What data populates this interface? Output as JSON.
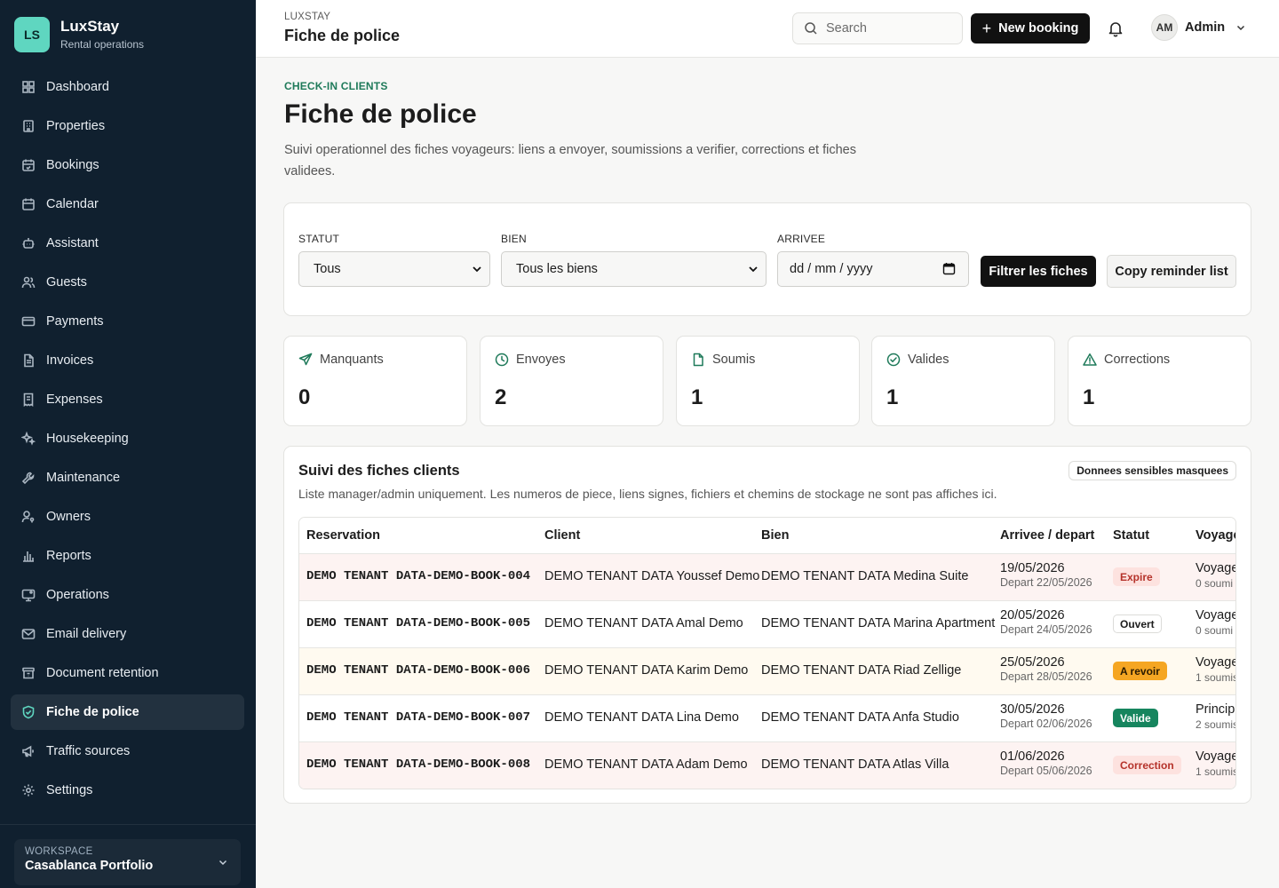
{
  "brand": {
    "initials": "LS",
    "name": "LuxStay",
    "subtitle": "Rental operations"
  },
  "sidebar": {
    "items": [
      {
        "label": "Dashboard",
        "icon": "dashboard-icon"
      },
      {
        "label": "Properties",
        "icon": "building-icon"
      },
      {
        "label": "Bookings",
        "icon": "calendar-check-icon"
      },
      {
        "label": "Calendar",
        "icon": "calendar-icon"
      },
      {
        "label": "Assistant",
        "icon": "bot-icon"
      },
      {
        "label": "Guests",
        "icon": "users-icon"
      },
      {
        "label": "Payments",
        "icon": "credit-card-icon"
      },
      {
        "label": "Invoices",
        "icon": "file-text-icon"
      },
      {
        "label": "Expenses",
        "icon": "receipt-icon"
      },
      {
        "label": "Housekeeping",
        "icon": "sparkles-icon"
      },
      {
        "label": "Maintenance",
        "icon": "wrench-icon"
      },
      {
        "label": "Owners",
        "icon": "user-key-icon"
      },
      {
        "label": "Reports",
        "icon": "bar-chart-icon"
      },
      {
        "label": "Operations",
        "icon": "monitor-icon"
      },
      {
        "label": "Email delivery",
        "icon": "mail-icon"
      },
      {
        "label": "Document retention",
        "icon": "archive-icon"
      },
      {
        "label": "Fiche de police",
        "icon": "shield-check-icon",
        "active": true
      },
      {
        "label": "Traffic sources",
        "icon": "megaphone-icon"
      },
      {
        "label": "Settings",
        "icon": "gear-icon"
      }
    ],
    "workspace": {
      "label": "WORKSPACE",
      "value": "Casablanca Portfolio"
    }
  },
  "topbar": {
    "kicker": "LUXSTAY",
    "title": "Fiche de police",
    "search_placeholder": "Search",
    "new_booking_label": "New booking",
    "user_initials": "AM",
    "user_name": "Admin"
  },
  "page": {
    "kicker": "CHECK-IN CLIENTS",
    "title": "Fiche de police",
    "intro": "Suivi operationnel des fiches voyageurs: liens a envoyer, soumissions a verifier, corrections et fiches validees."
  },
  "filters": {
    "statut": {
      "label": "STATUT",
      "value": "Tous"
    },
    "bien": {
      "label": "BIEN",
      "value": "Tous les biens"
    },
    "arrivee": {
      "label": "ARRIVEE",
      "placeholder": "dd / mm / yyyy"
    },
    "filter_button": "Filtrer les fiches",
    "copy_button": "Copy reminder list"
  },
  "stats": [
    {
      "label": "Manquants",
      "value": "0",
      "icon": "send-icon"
    },
    {
      "label": "Envoyes",
      "value": "2",
      "icon": "clock-icon"
    },
    {
      "label": "Soumis",
      "value": "1",
      "icon": "file-icon"
    },
    {
      "label": "Valides",
      "value": "1",
      "icon": "check-circle-icon"
    },
    {
      "label": "Corrections",
      "value": "1",
      "icon": "alert-triangle-icon"
    }
  ],
  "table": {
    "title": "Suivi des fiches clients",
    "subtitle": "Liste manager/admin uniquement. Les numeros de piece, liens signes, fichiers et chemins de stockage ne sont pas affiches ici.",
    "badge": "Donnees sensibles masquees",
    "headers": [
      "Reservation",
      "Client",
      "Bien",
      "Arrivee / depart",
      "Statut",
      "Voyage"
    ],
    "rows": [
      {
        "reservation": "DEMO TENANT DATA-DEMO-BOOK-004",
        "client": "DEMO TENANT DATA Youssef Demo",
        "bien": "DEMO TENANT DATA Medina Suite",
        "arrivee": "19/05/2026",
        "depart": "Depart 22/05/2026",
        "statut": "Expire",
        "voy1": "Voyage",
        "voy2": "0 soumi",
        "row_bg": "#fdf3f2",
        "status_bg": "#fde2df",
        "status_fg": "#b5322a",
        "status_border": "#fde2df"
      },
      {
        "reservation": "DEMO TENANT DATA-DEMO-BOOK-005",
        "client": "DEMO TENANT DATA Amal Demo",
        "bien": "DEMO TENANT DATA Marina Apartment",
        "arrivee": "20/05/2026",
        "depart": "Depart 24/05/2026",
        "statut": "Ouvert",
        "voy1": "Voyage",
        "voy2": "0 soumi",
        "row_bg": "#ffffff",
        "status_bg": "#ffffff",
        "status_fg": "#1c1c1c",
        "status_border": "#dcdcd9"
      },
      {
        "reservation": "DEMO TENANT DATA-DEMO-BOOK-006",
        "client": "DEMO TENANT DATA Karim Demo",
        "bien": "DEMO TENANT DATA Riad Zellige",
        "arrivee": "25/05/2026",
        "depart": "Depart 28/05/2026",
        "statut": "A revoir",
        "voy1": "Voyage",
        "voy2": "1 soumis",
        "row_bg": "#fffaf0",
        "status_bg": "#f5a623",
        "status_fg": "#2a1a00",
        "status_border": "#f5a623"
      },
      {
        "reservation": "DEMO TENANT DATA-DEMO-BOOK-007",
        "client": "DEMO TENANT DATA Lina Demo",
        "bien": "DEMO TENANT DATA Anfa Studio",
        "arrivee": "30/05/2026",
        "depart": "Depart 02/06/2026",
        "statut": "Valide",
        "voy1": "Princip",
        "voy2": "2 soumis",
        "row_bg": "#ffffff",
        "status_bg": "#16855e",
        "status_fg": "#ffffff",
        "status_border": "#16855e"
      },
      {
        "reservation": "DEMO TENANT DATA-DEMO-BOOK-008",
        "client": "DEMO TENANT DATA Adam Demo",
        "bien": "DEMO TENANT DATA Atlas Villa",
        "arrivee": "01/06/2026",
        "depart": "Depart 05/06/2026",
        "statut": "Correction",
        "voy1": "Voyage",
        "voy2": "1 soumis",
        "row_bg": "#fdf3f2",
        "status_bg": "#fde2df",
        "status_fg": "#b5322a",
        "status_border": "#fde2df"
      }
    ]
  }
}
